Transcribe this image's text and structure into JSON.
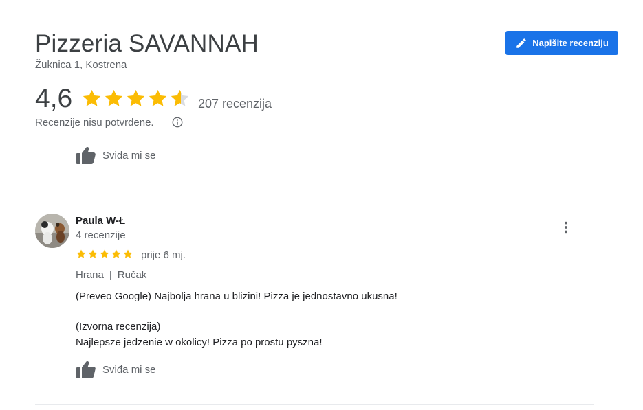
{
  "place": {
    "name": "Pizzeria SAVANNAH",
    "address": "Žuknica 1, Kostrena",
    "rating": "4,6",
    "rating_value": 4.6,
    "review_count": "207 recenzija",
    "unverified_note": "Recenzije nisu potvrđene."
  },
  "actions": {
    "write_review": "Napišite recenziju",
    "like_label": "Sviđa mi se"
  },
  "review": {
    "author": "Paula W-Ł",
    "author_reviews": "4 recenzije",
    "stars": 5,
    "time": "prije 6 mj.",
    "tag_1": "Hrana",
    "tag_sep": "|",
    "tag_2": "Ručak",
    "translated_text": "(Preveo Google) Najbolja hrana u blizini! Pizza je jednostavno ukusna!",
    "original_label": "(Izvorna recenzija)",
    "original_text": "Najlepsze jedzenie w okolicy! Pizza po prostu pyszna!"
  },
  "colors": {
    "accent": "#1a73e8",
    "star": "#fbbc04",
    "star_empty": "#dadce0",
    "secondary_text": "#5f6368",
    "divider": "#e8eaed"
  },
  "icons": [
    "pencil-icon",
    "star-icon",
    "info-icon",
    "thumbs-up-icon",
    "more-vert-icon"
  ]
}
